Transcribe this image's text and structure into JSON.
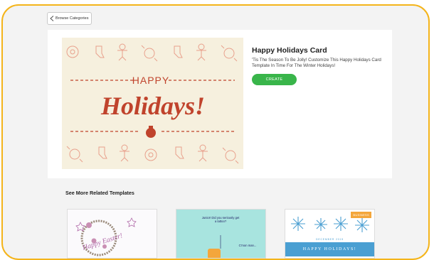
{
  "nav": {
    "back_label": "Browse Categories"
  },
  "template": {
    "title": "Happy Holidays Card",
    "description": "'Tis The Season To Be Jolly! Customize This Happy Holidays Card Template In Time For The Winter Holidays!",
    "create_label": "CREATE",
    "card": {
      "line1": "HAPPY",
      "line2": "Holidays!"
    }
  },
  "related": {
    "heading": "See More Related Templates",
    "items": [
      {
        "text": "Happy Easter!"
      },
      {
        "text_top": "Junior! Did you seriously get a tattoo?",
        "text_bottom": "C'mon man..."
      },
      {
        "badge": "BUSINESS",
        "date": "DECEMBER 2015",
        "banner": "HAPPY HOLIDAYS!"
      }
    ]
  },
  "colors": {
    "accent_green": "#39b54a",
    "frame_yellow": "#f4b41a",
    "card_red": "#c0432c"
  }
}
